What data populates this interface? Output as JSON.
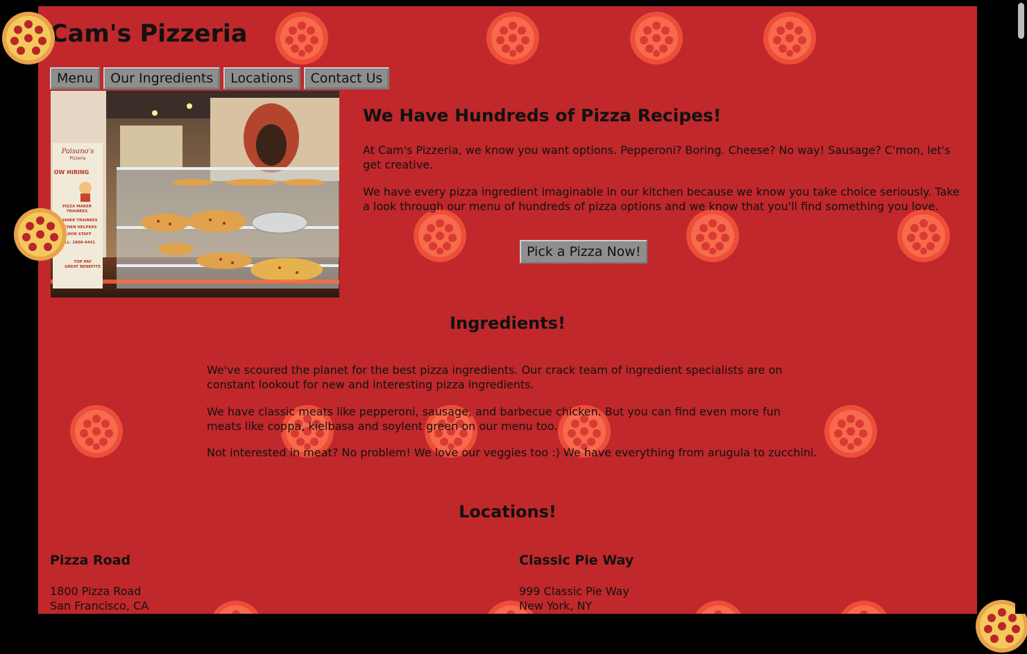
{
  "site": {
    "title": "Cam's Pizzeria"
  },
  "nav": {
    "items": [
      {
        "label": "Menu"
      },
      {
        "label": "Our Ingredients"
      },
      {
        "label": "Locations"
      },
      {
        "label": "Contact Us"
      }
    ]
  },
  "hero": {
    "heading": "We Have Hundreds of Pizza Recipes!",
    "p1": "At Cam's Pizzeria, we know you want options. Pepperoni? Boring. Cheese? No way! Sausage? C'mon, let's get creative.",
    "p2": "We have every pizza ingredient imaginable in our kitchen because we know you take choice seriously. Take a look through our menu of hundreds of pizza options and we know that you'll find something you love.",
    "cta_label": "Pick a Pizza Now!",
    "photo": {
      "sign_brand": "Paisano's",
      "sign_sub": "Pizzeria",
      "sign_hiring": "OW HIRING",
      "sign_lines": [
        "PIZZA MAKER",
        "TRAINEES",
        "CASHIER TRAINEES",
        "KITCHEN HELPERS",
        "FLOOR STAFF",
        "CALL: 2808-4441",
        "TOP PAY",
        "GREAT BENEFITS"
      ]
    }
  },
  "ingredients": {
    "heading": "Ingredients!",
    "p1": "We've scoured the planet for the best pizza ingredients. Our crack team of ingredient specialists are on constant lookout for new and interesting pizza ingredients.",
    "p2": "We have classic meats like pepperoni, sausage, and barbecue chicken. But you can find even more fun meats like coppa, kielbasa and soylent green on our menu too.",
    "p3": "Not interested in meat? No problem! We love our veggies too :) We have everything from arugula to zucchini."
  },
  "locations": {
    "heading": "Locations!",
    "items": [
      {
        "name": "Pizza Road",
        "line1": "1800 Pizza Road",
        "line2": "San Francisco, CA"
      },
      {
        "name": "Classic Pie Way",
        "line1": "999 Classic Pie Way",
        "line2": "New York, NY"
      }
    ]
  },
  "colors": {
    "page_background": "#c0282b",
    "outer_background": "#000000",
    "button_gray": "#8e8e8e",
    "pizza_orange": "#f0533a"
  },
  "icons": {
    "background_pattern": "pizza-icon"
  }
}
